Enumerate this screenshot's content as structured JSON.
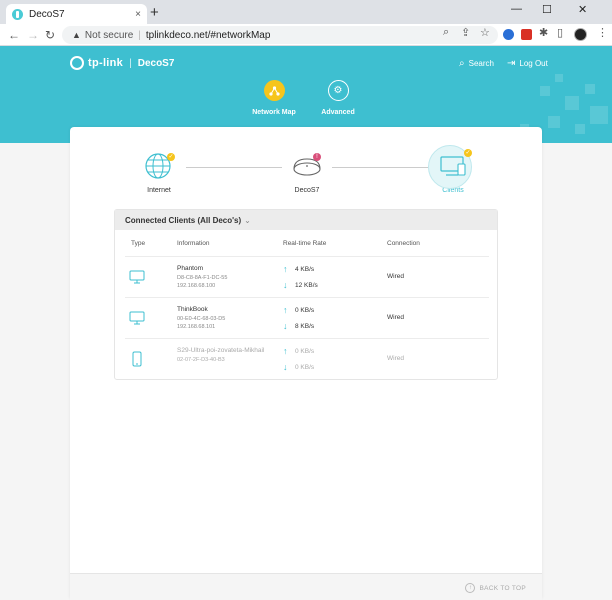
{
  "browser": {
    "tab_title": "DecoS7",
    "tab_close": "×",
    "new_tab": "+",
    "window_controls": [
      "—",
      "☐",
      "✕"
    ],
    "security_label": "Not secure",
    "url": "tplinkdeco.net/#networkMap"
  },
  "header": {
    "brand": "tp-link",
    "model": "DecoS7",
    "search_label": "Search",
    "logout_label": "Log Out"
  },
  "nav": {
    "items": [
      {
        "label": "Network Map",
        "active": true
      },
      {
        "label": "Advanced",
        "active": false
      }
    ]
  },
  "topology": {
    "internet_label": "Internet",
    "deco_label": "DecoS7",
    "clients_label": "Clients",
    "deco_badge": "!"
  },
  "clients": {
    "title": "Connected Clients (All Deco's)",
    "columns": [
      "Type",
      "Information",
      "Real-time Rate",
      "Connection"
    ],
    "rows": [
      {
        "name": "Phantom",
        "mac": "D8-C8-8A-F1-DC-55",
        "ip": "192.168.68.100",
        "up": "4 KB/s",
        "down": "12 KB/s",
        "connection": "Wired",
        "device": "monitor"
      },
      {
        "name": "ThinkBook",
        "mac": "00-E0-4C-68-03-D5",
        "ip": "192.168.68.101",
        "up": "0 KB/s",
        "down": "8 KB/s",
        "connection": "Wired",
        "device": "monitor"
      },
      {
        "name": "S29-Ultra-poi-zovateta-Mikhail",
        "mac": "02-07-2F-D3-40-B3",
        "ip": "",
        "up": "0 KB/s",
        "down": "0 KB/s",
        "connection": "Wired",
        "device": "phone"
      }
    ]
  },
  "footer": {
    "back_to_top": "BACK TO TOP"
  },
  "colors": {
    "accent": "#3ebfd0",
    "active_nav": "#f6c51c",
    "alert": "#d94f7a"
  }
}
